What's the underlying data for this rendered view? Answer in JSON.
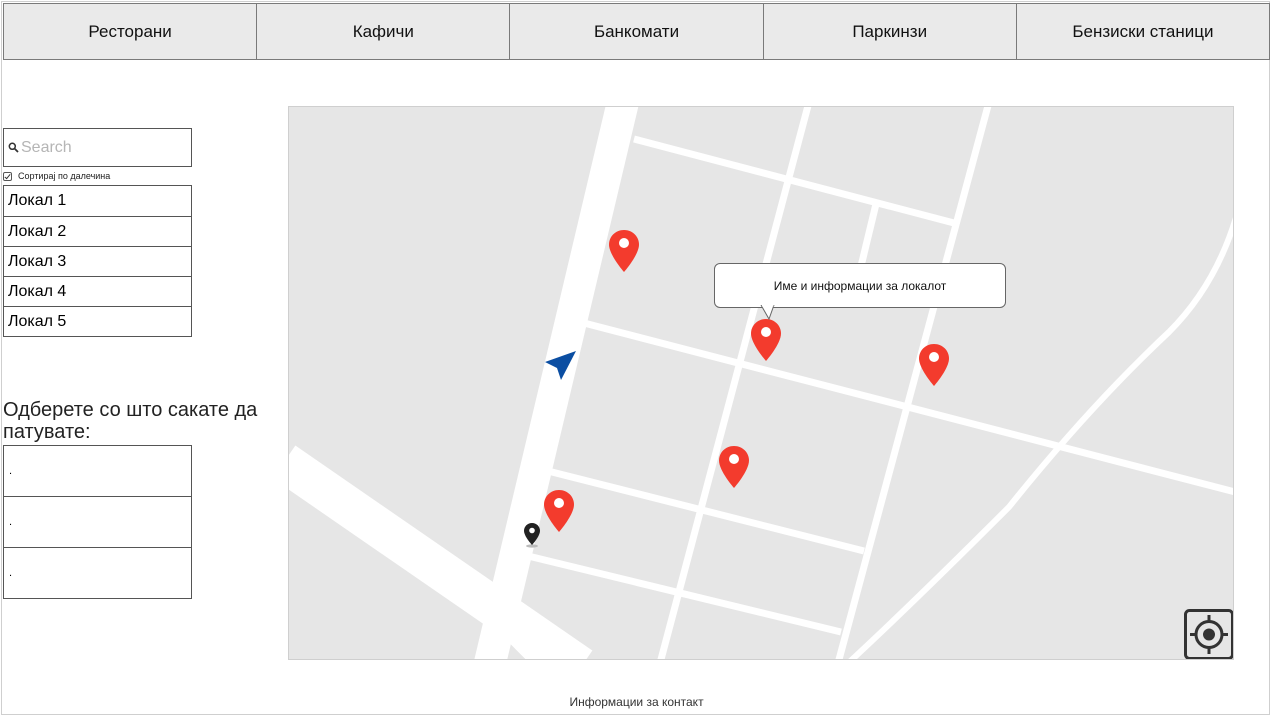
{
  "tabs": [
    {
      "label": "Ресторани"
    },
    {
      "label": "Кафичи"
    },
    {
      "label": "Банкомати"
    },
    {
      "label": "Паркинзи"
    },
    {
      "label": "Бензиски станици"
    }
  ],
  "search": {
    "placeholder": "Search",
    "icon": "search-icon"
  },
  "sort": {
    "label": "Сортирај по далечина",
    "checked": true
  },
  "places": [
    {
      "label": "Локал 1"
    },
    {
      "label": "Локал 2"
    },
    {
      "label": "Локал 3"
    },
    {
      "label": "Локал 4"
    },
    {
      "label": "Локал 5"
    }
  ],
  "travel": {
    "heading": "Одберете со што сакате да патувате:",
    "options": [
      {
        "label": "."
      },
      {
        "label": "."
      },
      {
        "label": "."
      }
    ]
  },
  "map": {
    "tooltip": "Име и информации за локалот",
    "pin_color": "#f33b2d",
    "user_arrow_color": "#0b4ea2",
    "locate_icon": "crosshair-icon"
  },
  "footer": {
    "contact": "Информации за контакт"
  }
}
